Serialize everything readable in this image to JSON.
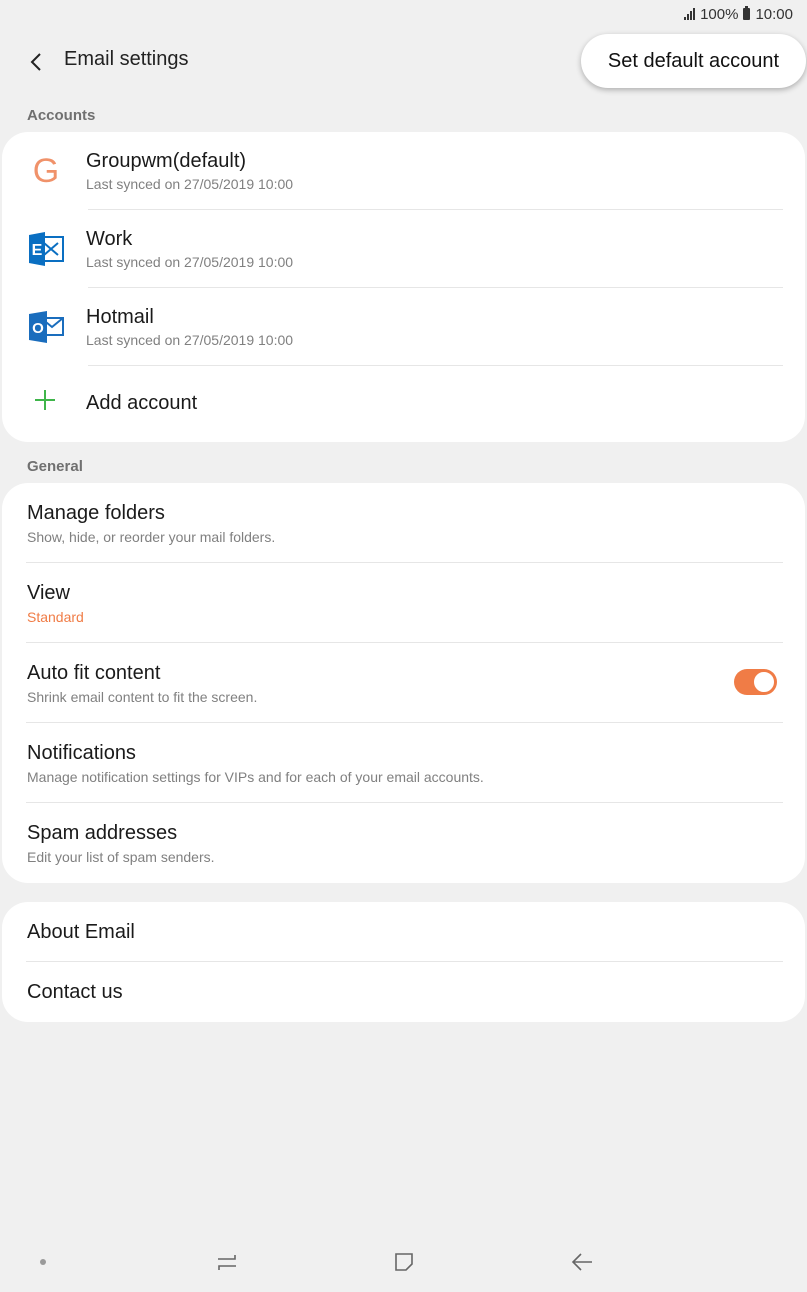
{
  "status_bar": {
    "battery": "100%",
    "time": "10:00"
  },
  "header": {
    "title": "Email settings",
    "set_default_label": "Set default account"
  },
  "accounts": {
    "section_label": "Accounts",
    "items": [
      {
        "name": "Groupwm(default)",
        "sync": "Last synced on 27/05/2019  10:00",
        "icon": "groupwm-letter-g-icon",
        "letter": "G"
      },
      {
        "name": "Work",
        "sync": "Last synced on 27/05/2019  10:00",
        "icon": "exchange-icon",
        "letter": "E"
      },
      {
        "name": "Hotmail",
        "sync": "Last synced on 27/05/2019  10:00",
        "icon": "outlook-icon",
        "letter": "O"
      }
    ],
    "add_label": "Add account"
  },
  "general": {
    "section_label": "General",
    "items": [
      {
        "title": "Manage folders",
        "subtitle": "Show, hide, or reorder your mail folders."
      },
      {
        "title": "View",
        "subtitle": "Standard"
      },
      {
        "title": "Auto fit content",
        "subtitle": "Shrink email content to fit the screen.",
        "toggle_on": true
      },
      {
        "title": "Notifications",
        "subtitle": "Manage notification settings for VIPs and for each of your email accounts."
      },
      {
        "title": "Spam addresses",
        "subtitle": "Edit your list of spam senders."
      }
    ]
  },
  "about": {
    "items": [
      {
        "title": "About Email"
      },
      {
        "title": "Contact us"
      }
    ]
  },
  "colors": {
    "accent": "#f07c46",
    "add_green": "#3fb54a",
    "exchange_blue": "#0a6fc2",
    "outlook_blue": "#1a6dbd"
  }
}
